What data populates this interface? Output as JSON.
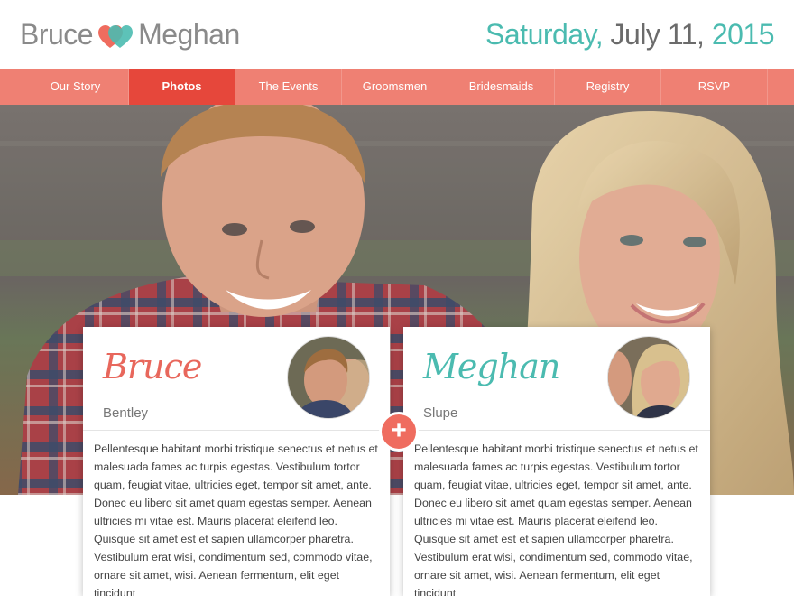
{
  "header": {
    "groom": "Bruce",
    "bride": "Meghan",
    "date_weekday": "Saturday,",
    "date_month_day": " July 11,",
    "date_year": " 2015"
  },
  "nav": {
    "items": [
      {
        "label": "Our Story"
      },
      {
        "label": "Photos"
      },
      {
        "label": "The Events"
      },
      {
        "label": "Groomsmen"
      },
      {
        "label": "Bridesmaids"
      },
      {
        "label": "Registry"
      },
      {
        "label": "RSVP"
      }
    ],
    "active": "Photos"
  },
  "cards": {
    "groom": {
      "first": "Bruce",
      "last": "Bentley",
      "bio": "Pellentesque habitant morbi tristique senectus et netus et malesuada fames ac turpis egestas. Vestibulum tortor quam, feugiat vitae, ultricies eget, tempor sit amet, ante. Donec eu libero sit amet quam egestas semper. Aenean ultricies mi vitae est. Mauris placerat eleifend leo. Quisque sit amet est et sapien ullamcorper pharetra. Vestibulum erat wisi, condimentum sed, commodo vitae, ornare sit amet, wisi. Aenean fermentum, elit eget tincidunt"
    },
    "bride": {
      "first": "Meghan",
      "last": "Slupe",
      "bio": "Pellentesque habitant morbi tristique senectus et netus et malesuada fames ac turpis egestas. Vestibulum tortor quam, feugiat vitae, ultricies eget, tempor sit amet, ante. Donec eu libero sit amet quam egestas semper. Aenean ultricies mi vitae est. Mauris placerat eleifend leo. Quisque sit amet est et sapien ullamcorper pharetra. Vestibulum erat wisi, condimentum sed, commodo vitae, ornare sit amet, wisi. Aenean fermentum, elit eget tincidunt"
    }
  },
  "plus_symbol": "+",
  "colors": {
    "accent_teal": "#4bbbb0",
    "accent_coral": "#ef8073",
    "nav_active": "#e6473b"
  }
}
